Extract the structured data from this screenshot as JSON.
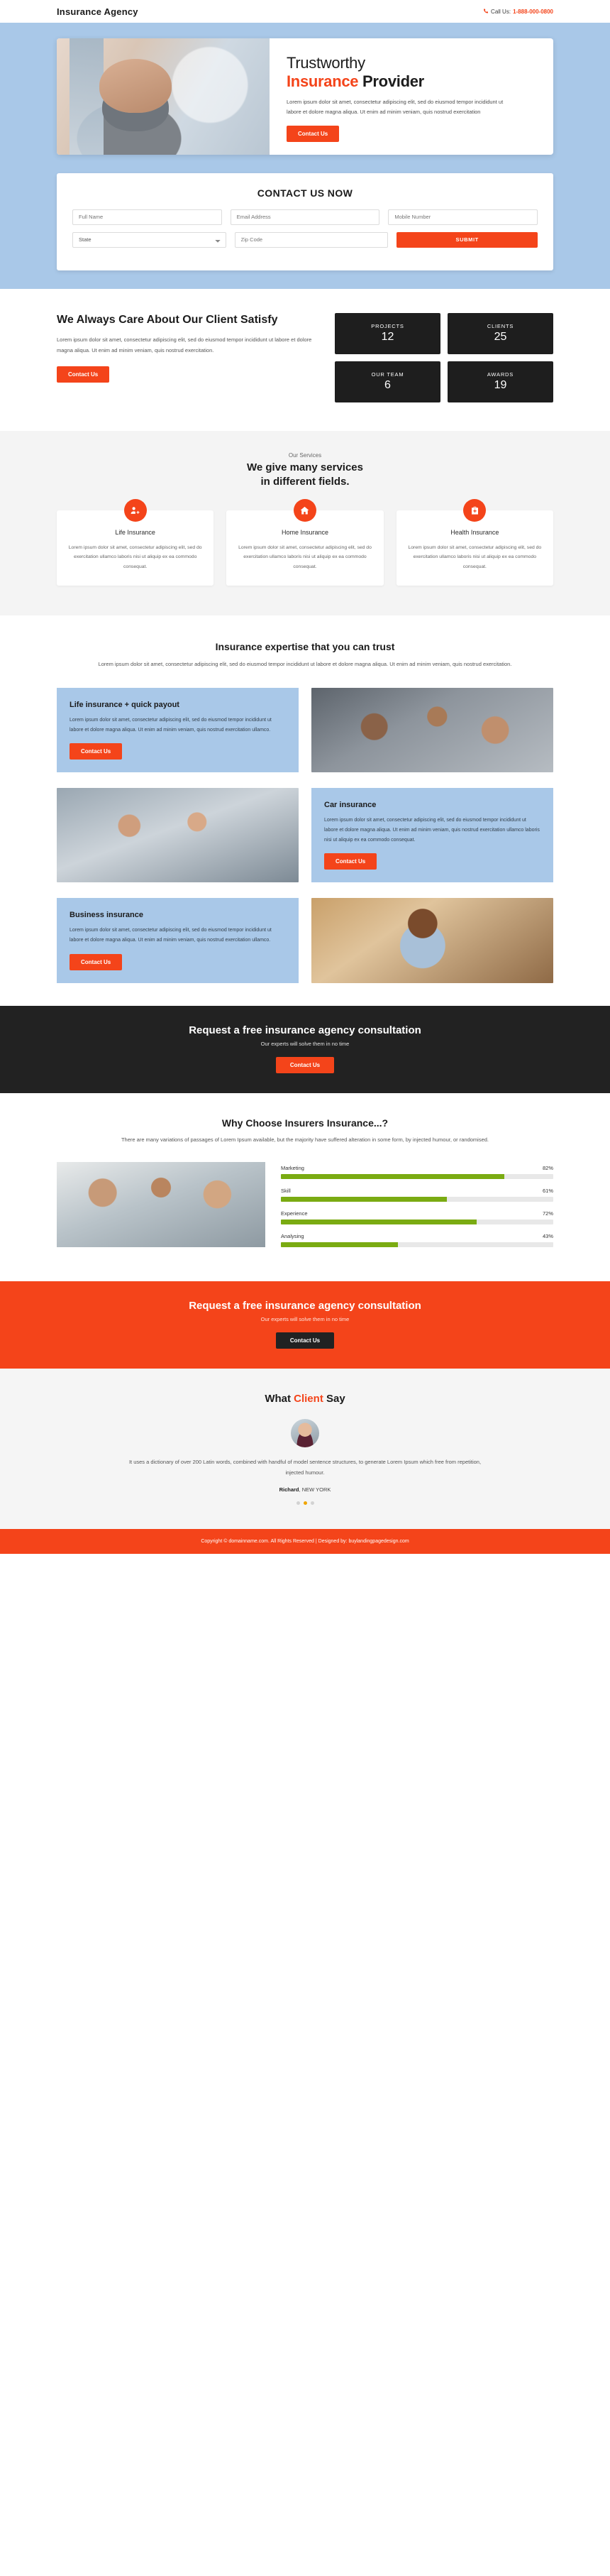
{
  "topbar": {
    "brand": "Insurance Agency",
    "call_label": "Call Us:",
    "phone": "1-888-000-0800"
  },
  "hero": {
    "title_line1": "Trustworthy",
    "title_accent": "Insurance",
    "title_rest": " Provider",
    "paragraph": "Lorem ipsum dolor sit amet, consectetur adipiscing elit, sed do eiusmod tempor incididunt ut labore et dolore magna aliqua. Ut enim ad minim veniam, quis nostrud exercitation",
    "cta": "Contact Us"
  },
  "contact_form": {
    "heading": "CONTACT US NOW",
    "fields": [
      {
        "name": "full-name",
        "placeholder": "Full Name",
        "value": ""
      },
      {
        "name": "email-address",
        "placeholder": "Email Address",
        "value": ""
      },
      {
        "name": "mobile-number",
        "placeholder": "Mobile Number",
        "value": ""
      }
    ],
    "state_label": "State",
    "zip_placeholder": "Zip Code",
    "submit": "SUBMIT"
  },
  "care": {
    "heading": "We Always Care About Our Client Satisfy",
    "paragraph": "Lorem ipsum dolor sit amet, consectetur adipiscing elit, sed do eiusmod tempor incididunt ut labore et dolore magna aliqua. Ut enim ad minim veniam, quis nostrud exercitation.",
    "cta": "Contact Us",
    "stats": [
      {
        "label": "PROJECTS",
        "value": "12"
      },
      {
        "label": "CLIENTS",
        "value": "25"
      },
      {
        "label": "OUR TEAM",
        "value": "6"
      },
      {
        "label": "AWARDS",
        "value": "19"
      }
    ]
  },
  "services": {
    "eyebrow": "Our Services",
    "heading_line1": "We give many services",
    "heading_line2": "in different fields.",
    "cards": [
      {
        "icon": "user-plus-icon",
        "glyph": "♟",
        "title": "Life Insurance",
        "text": "Lorem ipsum dolor sit amet, consectetur adipiscing elit, sed do exercitation ullamco laboris nisi ut aliquip ex ea commodo consequat."
      },
      {
        "icon": "home-icon",
        "glyph": "⌂",
        "title": "Home Insurance",
        "text": "Lorem ipsum dolor sit amet, consectetur adipiscing elit, sed do exercitation ullamco laboris nisi ut aliquip ex ea commodo consequat."
      },
      {
        "icon": "medical-kit-icon",
        "glyph": "✚",
        "title": "Health Insurance",
        "text": "Lorem ipsum dolor sit amet, consectetur adipiscing elit, sed do exercitation ullamco laboris nisi ut aliquip ex ea commodo consequat."
      }
    ]
  },
  "expertise": {
    "heading": "Insurance expertise that you can trust",
    "paragraph": "Lorem ipsum dolor sit amet, consectetur adipiscing elit, sed do eiusmod tempor incididunt ut labore et dolore magna aliqua. Ut enim ad minim veniam, quis nostrud exercitation.",
    "items": [
      {
        "title": "Life insurance + quick payout",
        "text": "Lorem ipsum dolor sit amet, consectetur adipiscing elit, sed do eiusmod tempor incididunt ut labore et dolore magna aliqua. Ut enim ad minim veniam, quis nostrud exercitation ullamco.",
        "cta": "Contact Us"
      },
      {
        "title": "Car insurance",
        "text": "Lorem ipsum dolor sit amet, consectetur adipiscing elit, sed do eiusmod tempor incididunt ut labore et dolore magna aliqua. Ut enim ad minim veniam, quis nostrud exercitation ullamco laboris nisi ut aliquip ex ea commodo consequat.",
        "cta": "Contact Us"
      },
      {
        "title": "Business insurance",
        "text": "Lorem ipsum dolor sit amet, consectetur adipiscing elit, sed do eiusmod tempor incididunt ut labore et dolore magna aliqua. Ut enim ad minim veniam, quis nostrud exercitation ullamco.",
        "cta": "Contact Us"
      }
    ]
  },
  "cta_dark": {
    "heading": "Request a free insurance agency consultation",
    "sub": "Our experts will solve them in no time",
    "button": "Contact Us"
  },
  "why": {
    "heading": "Why Choose Insurers Insurance...?",
    "paragraph": "There are many variations of passages of Lorem Ipsum available, but the majority have suffered alteration in some form, by injected humour, or randomised."
  },
  "cta_orange": {
    "heading": "Request a free insurance agency consultation",
    "sub": "Our experts will solve them in no time",
    "button": "Contact Us"
  },
  "testimonial": {
    "heading_pre": "What ",
    "heading_accent": "Client",
    "heading_post": " Say",
    "quote": "It uses a dictionary of over 200 Latin words, combined with handful of model sentence structures, to generate Lorem Ipsum which free from repetition, injected humour.",
    "author": "Richard",
    "location": ", NEW YORK",
    "dots": 3,
    "active_dot": 1
  },
  "footer": {
    "text": "Copyright © domainname.com. All Rights Reserved | Designed by: buylandingpagedesign.com"
  },
  "colors": {
    "accent": "#f4441a",
    "hero_blue": "#a9c8e8",
    "dark": "#222222",
    "bar_green": "#7aab12",
    "dot_active": "#f0a500"
  },
  "chart_data": {
    "type": "bar",
    "orientation": "horizontal",
    "title": "Why Choose Insurers Insurance...?",
    "categories": [
      "Marketing",
      "Skill",
      "Experience",
      "Analysing"
    ],
    "values": [
      82,
      61,
      72,
      43
    ],
    "value_labels": [
      "82%",
      "61%",
      "72%",
      "43%"
    ],
    "xlabel": "",
    "ylabel": "",
    "xlim": [
      0,
      100
    ],
    "grid": false,
    "legend": false,
    "bar_color": "#7aab12",
    "track_color": "#e8e8e8"
  }
}
